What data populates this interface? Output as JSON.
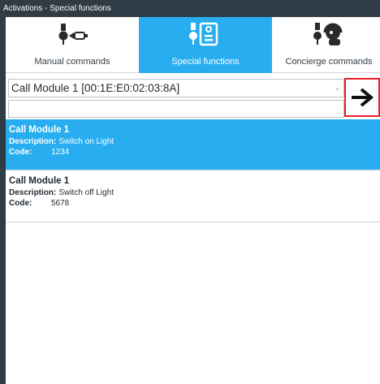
{
  "window": {
    "title": "Activations - Special functions"
  },
  "tabs": [
    {
      "label": "Manual commands",
      "icon": "key-lock-icon",
      "selected": false
    },
    {
      "label": "Special functions",
      "icon": "key-card-icon",
      "selected": true
    },
    {
      "label": "Concierge commands",
      "icon": "key-concierge-icon",
      "selected": false
    }
  ],
  "module_select": {
    "value": "Call Module 1 [00:1E:E0:02:03:8A]"
  },
  "search": {
    "value": ""
  },
  "items": [
    {
      "title": "Call Module 1",
      "description_label": "Description:",
      "description": "Switch on Light",
      "code_label": "Code:",
      "code": "1234",
      "selected": true
    },
    {
      "title": "Call Module 1",
      "description_label": "Description:",
      "description": "Switch off Light",
      "code_label": "Code:",
      "code": "5678",
      "selected": false
    }
  ],
  "colors": {
    "selection": "#28aef0",
    "frame": "#2f3b45",
    "highlight_border": "#e8202a"
  }
}
